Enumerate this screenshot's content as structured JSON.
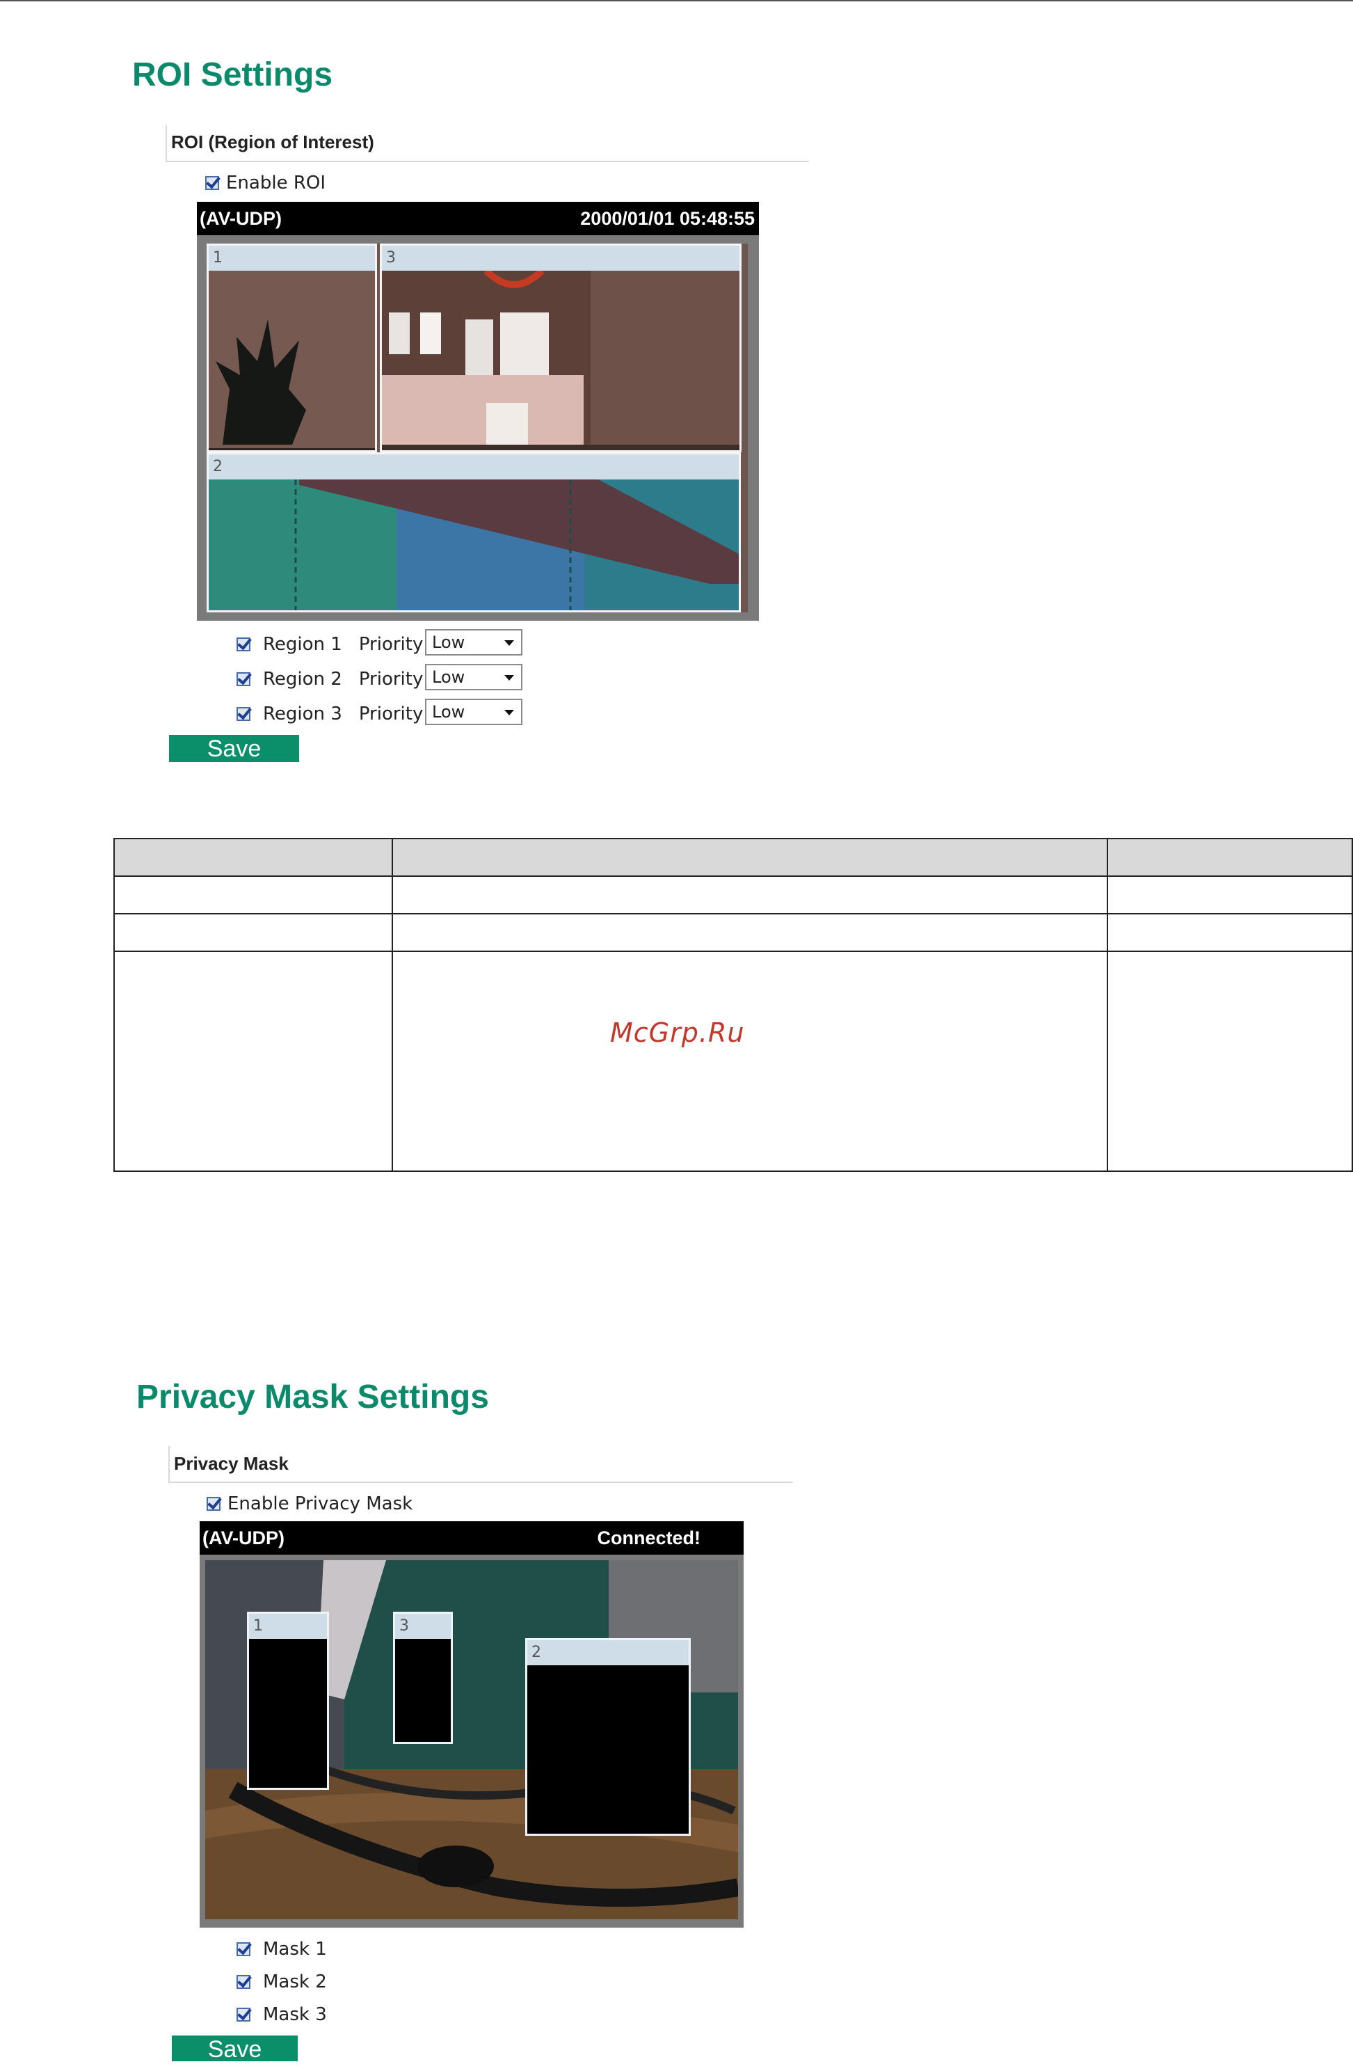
{
  "roi": {
    "title": "ROI Settings",
    "legend": "ROI (Region of Interest)",
    "enable_label": "Enable ROI",
    "video": {
      "source": "(AV-UDP)",
      "timestamp": "2000/01/01 05:48:55"
    },
    "regions": [
      {
        "number": "1",
        "label": "Region 1",
        "priority_label": "Priority",
        "priority": "Low",
        "checked": true
      },
      {
        "number": "2",
        "label": "Region 2",
        "priority_label": "Priority",
        "priority": "Low",
        "checked": true
      },
      {
        "number": "3",
        "label": "Region 3",
        "priority_label": "Priority",
        "priority": "Low",
        "checked": true
      }
    ],
    "save_label": "Save"
  },
  "watermark": "McGrp.Ru",
  "privacy": {
    "title": "Privacy Mask Settings",
    "legend": "Privacy Mask",
    "enable_label": "Enable Privacy Mask",
    "video": {
      "source": "(AV-UDP)",
      "status": "Connected!"
    },
    "masks": [
      {
        "number": "1",
        "label": "Mask 1",
        "checked": true
      },
      {
        "number": "2",
        "label": "Mask 2",
        "checked": true
      },
      {
        "number": "3",
        "label": "Mask 3",
        "checked": true
      }
    ],
    "save_label": "Save"
  },
  "colors": {
    "accent": "#0a8a6a",
    "button": "#0b8f6a",
    "region_header": "#cfdde9"
  }
}
